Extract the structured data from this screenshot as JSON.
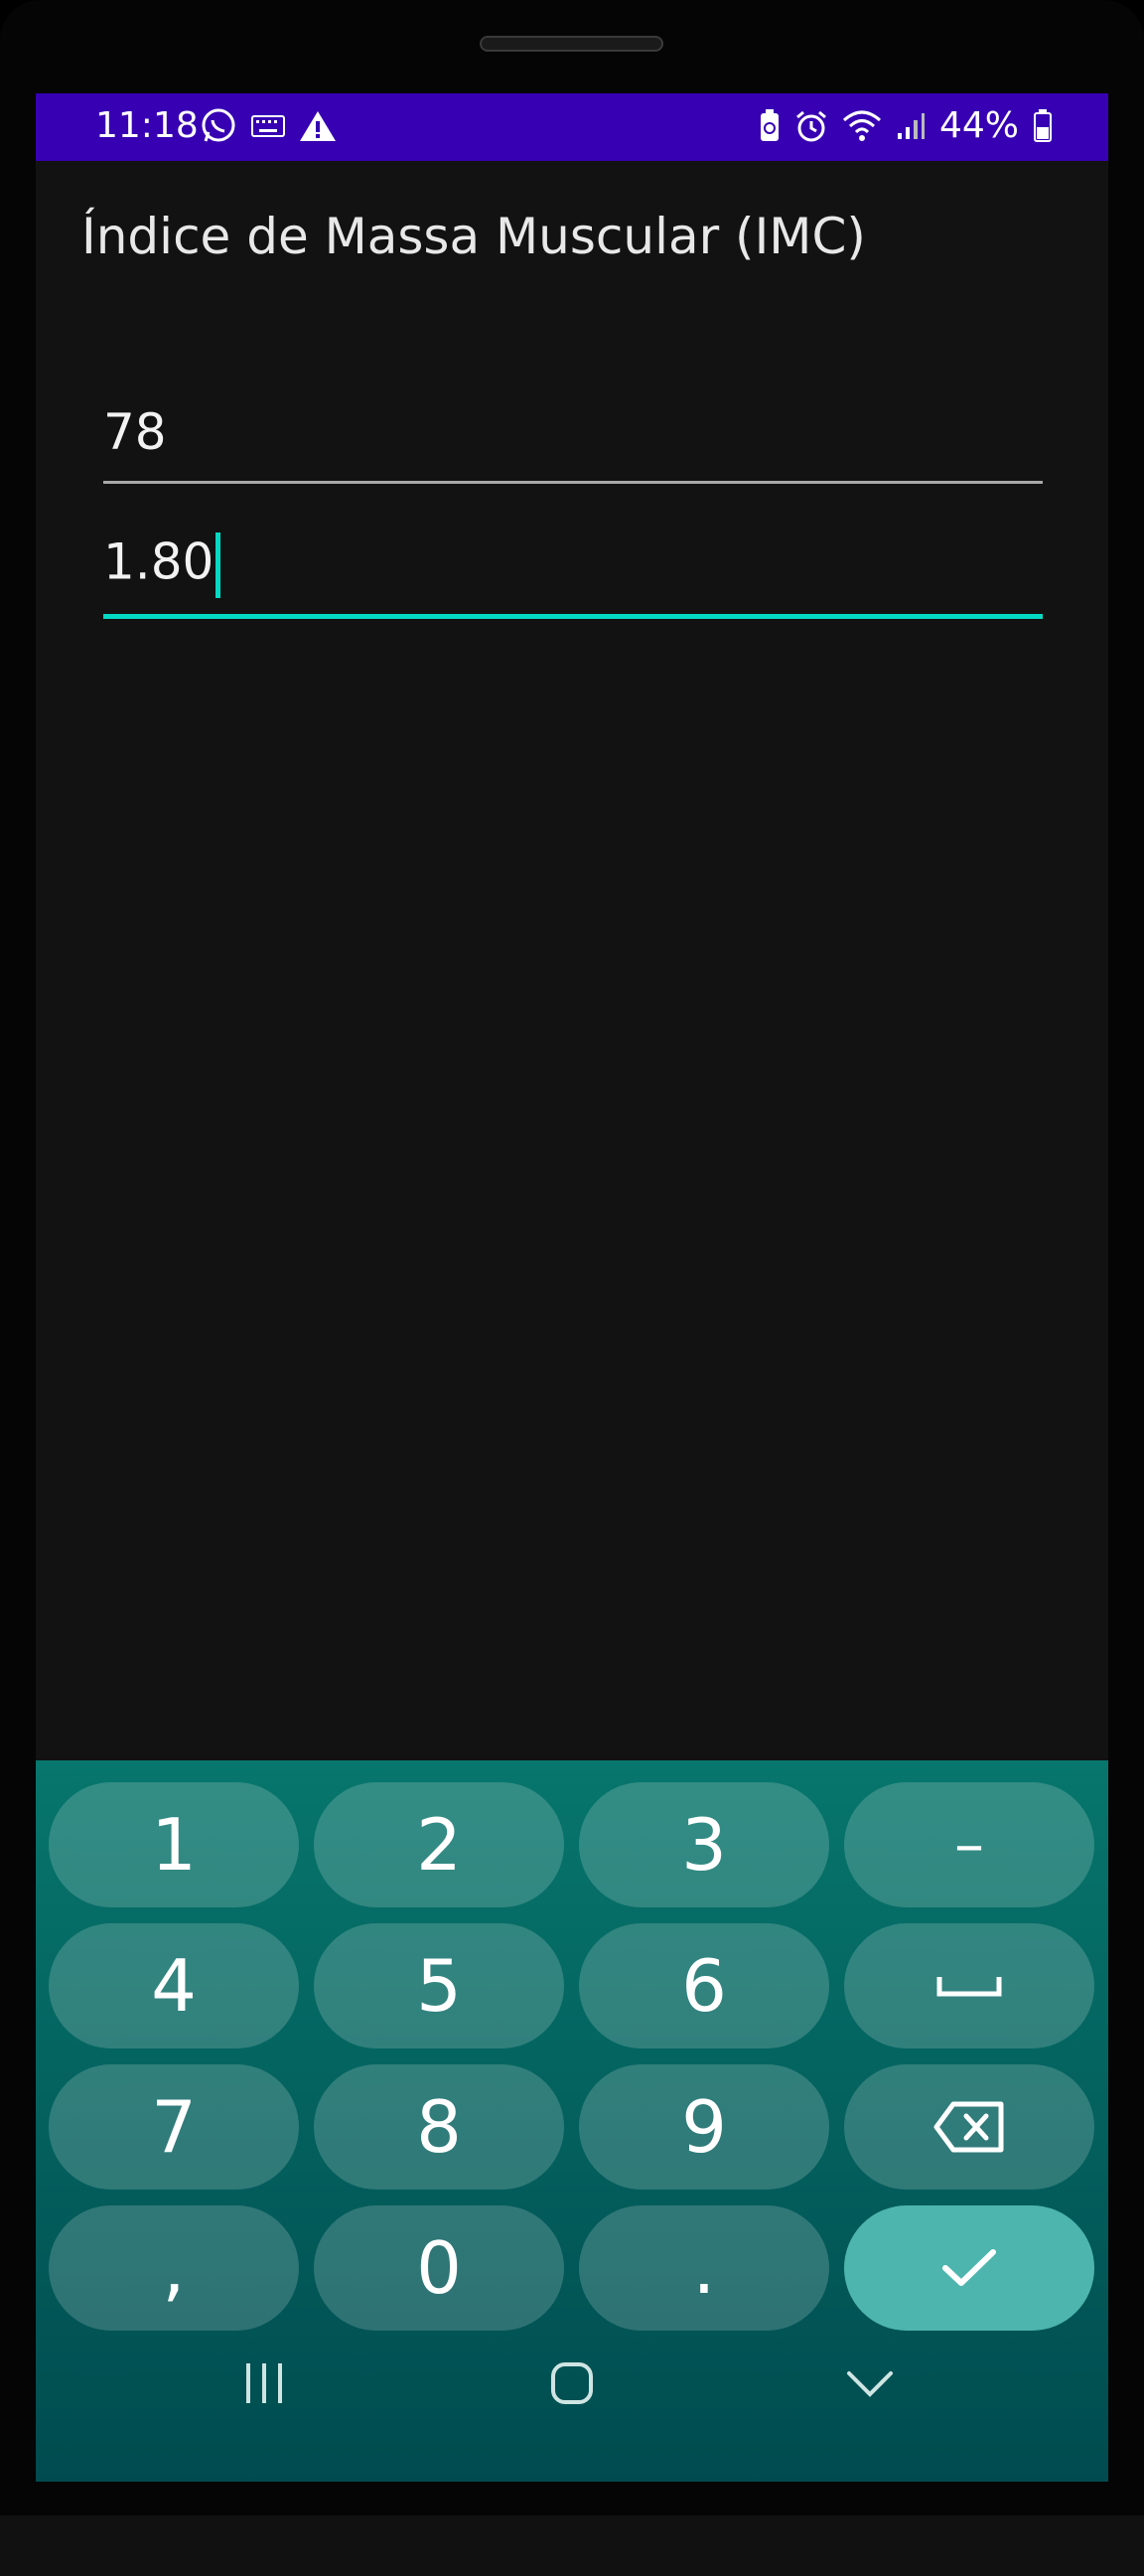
{
  "status_bar": {
    "time": "11:18",
    "battery": "44%",
    "left_icons": [
      "whatsapp-icon",
      "keyboard-icon",
      "warning-icon"
    ],
    "right_icons": [
      "battery-saver-icon",
      "alarm-icon",
      "wifi-icon",
      "signal-icon",
      "battery-icon"
    ]
  },
  "app": {
    "title": "Índice de Massa Muscular (IMC)"
  },
  "fields": {
    "weight": {
      "value": "78"
    },
    "height": {
      "value": "1.80"
    }
  },
  "colors": {
    "status_bar": "#3700b3",
    "background": "#121212",
    "accent": "#03dac5",
    "keyboard_top": "#07766c",
    "keyboard_bottom": "#004b4f",
    "enter_key": "#4db5ad"
  },
  "keyboard": {
    "rows": [
      [
        "1",
        "2",
        "3",
        "–"
      ],
      [
        "4",
        "5",
        "6",
        "space-icon"
      ],
      [
        "7",
        "8",
        "9",
        "backspace-icon"
      ],
      [
        ",",
        "0",
        ".",
        "check-icon"
      ]
    ]
  },
  "navigation": [
    "recent-apps-icon",
    "home-icon",
    "hide-keyboard-icon"
  ]
}
